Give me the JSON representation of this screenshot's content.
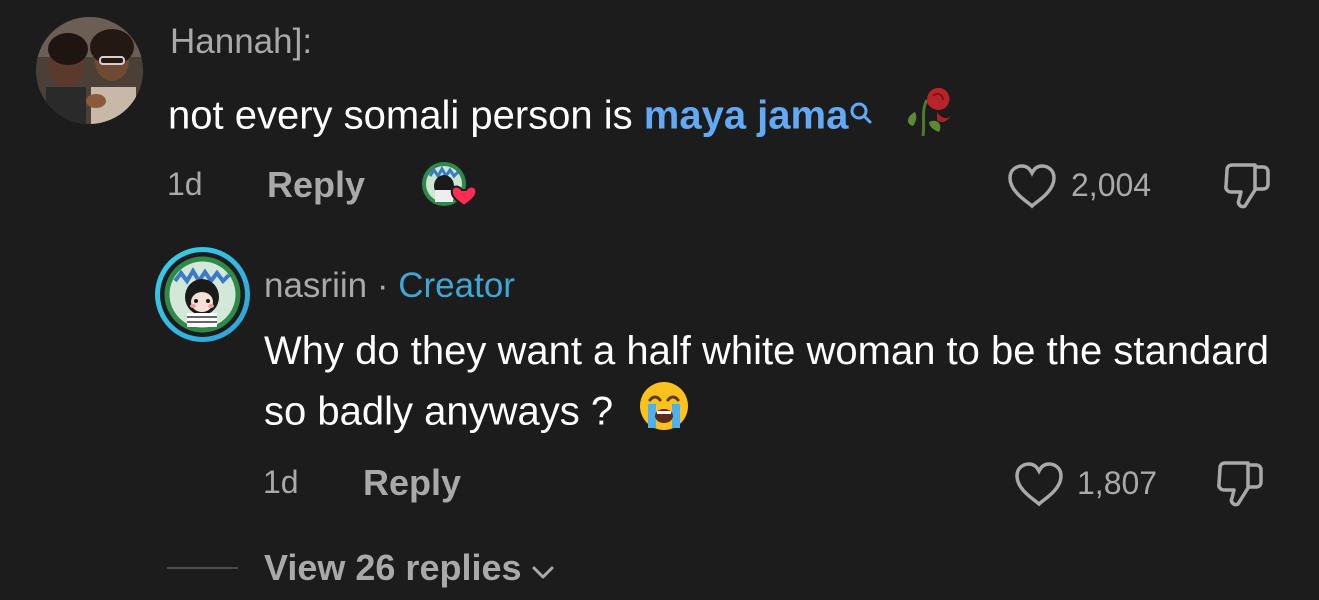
{
  "comments": [
    {
      "username": "Hannah]:",
      "text_before": "not every somali person is ",
      "link_text": "maya jama",
      "age": "1d",
      "reply_label": "Reply",
      "likes": "2,004",
      "liked_by_creator": true
    }
  ],
  "replies": [
    {
      "username": "nasriin",
      "separator": "·",
      "badge": "Creator",
      "text": "Why do they want a half white woman to be the standard so badly anyways ?",
      "age": "1d",
      "reply_label": "Reply",
      "likes": "1,807"
    }
  ],
  "view_replies_label": "View 26 replies",
  "colors": {
    "background": "#1c1c1c",
    "link": "#63aaf6",
    "creator_badge": "#3ea7d6",
    "secondary_text": "#a9a9a9",
    "heart_badge": "#fe2c55"
  }
}
